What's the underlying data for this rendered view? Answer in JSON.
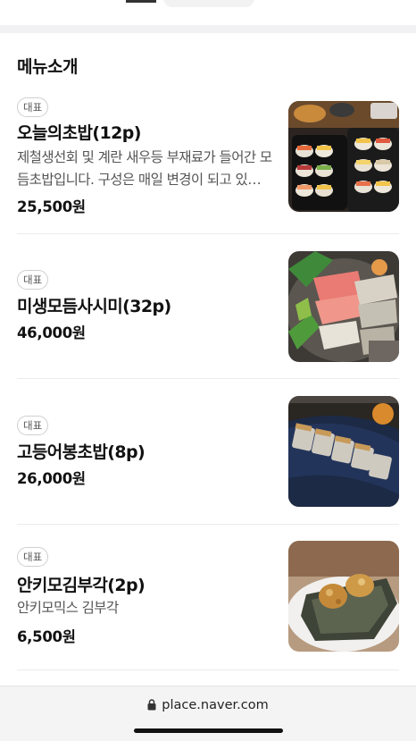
{
  "section": {
    "title": "메뉴소개"
  },
  "menu": [
    {
      "badge": "대표",
      "name": "오늘의초밥(12p)",
      "description": "제철생선회 및 계란 새우등 부재료가 들어간 모듬초밥입니다. 구성은 매일 변경이 되고 있습니다.",
      "price": "25,500원",
      "image_icon": "sushi-platter-photo"
    },
    {
      "badge": "대표",
      "name": "미생모듬사시미(32p)",
      "description": "",
      "price": "46,000원",
      "image_icon": "sashimi-platter-photo"
    },
    {
      "badge": "대표",
      "name": "고등어봉초밥(8p)",
      "description": "",
      "price": "26,000원",
      "image_icon": "mackerel-sushi-photo"
    },
    {
      "badge": "대표",
      "name": "안키모김부각(2p)",
      "description": "안키모믹스 김부각",
      "price": "6,500원",
      "image_icon": "ankimo-seaweed-photo"
    }
  ],
  "browser": {
    "url": "place.naver.com",
    "lock_icon": "lock-icon"
  }
}
